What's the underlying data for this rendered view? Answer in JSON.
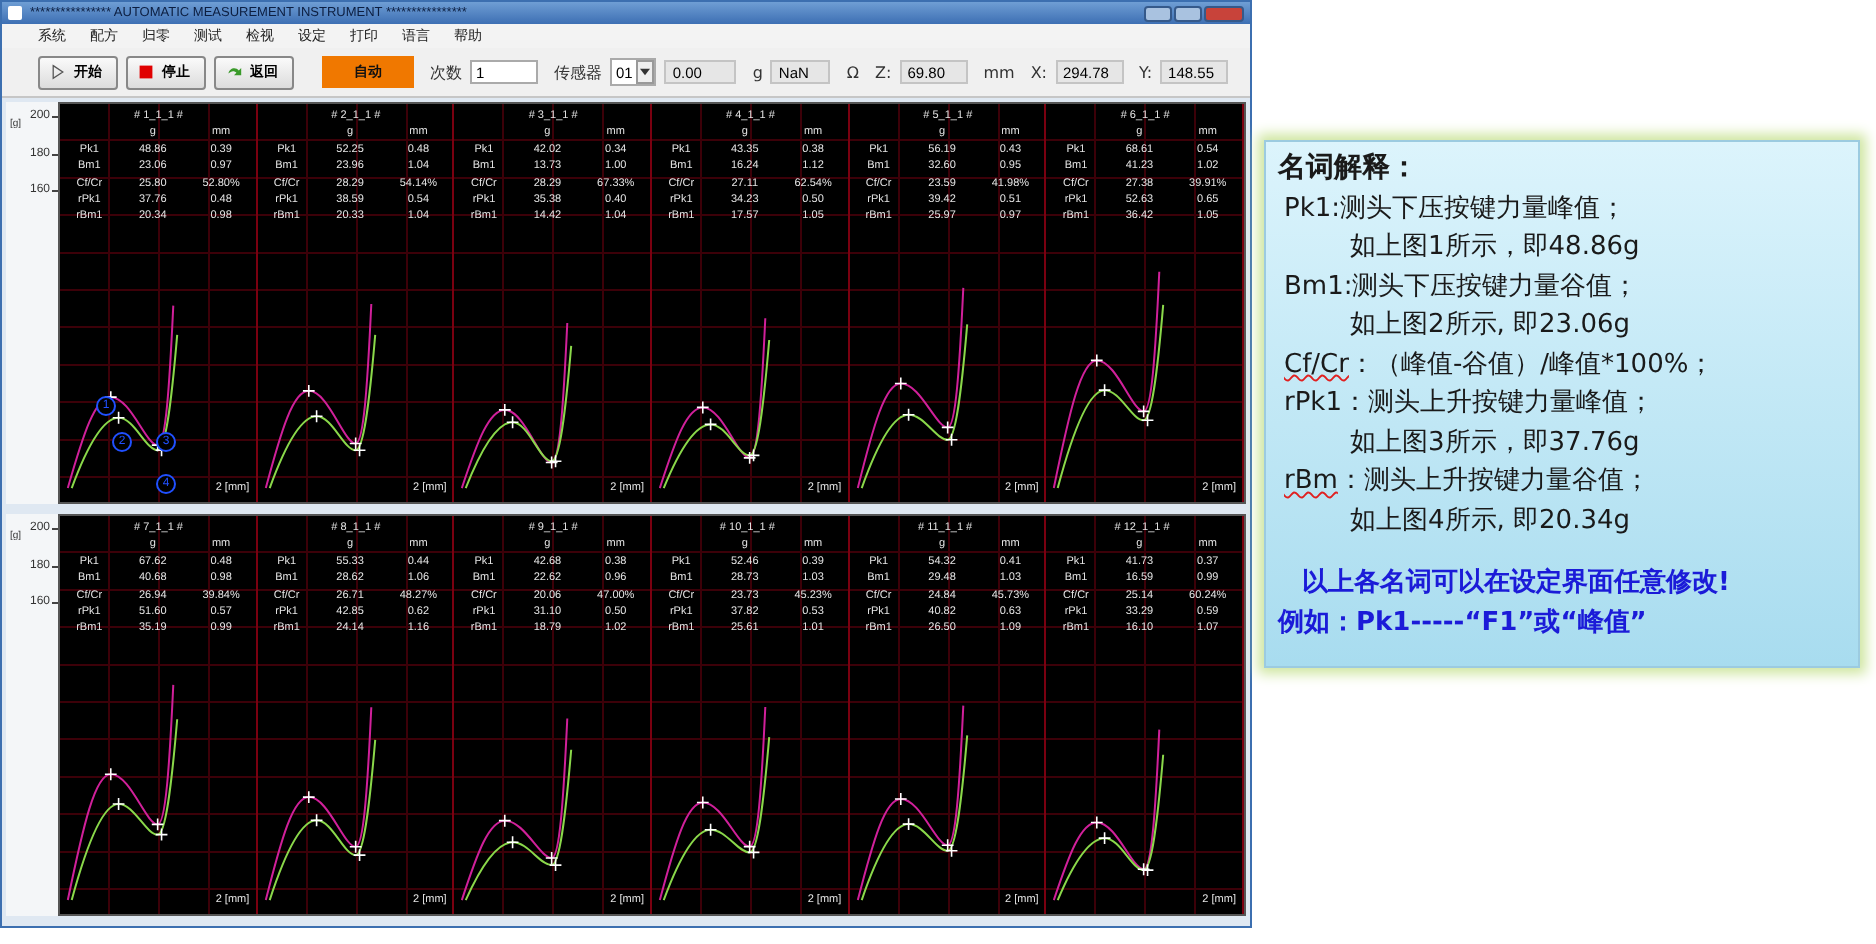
{
  "window": {
    "title": "**************** AUTOMATIC MEASUREMENT INSTRUMENT ****************"
  },
  "menu": [
    "系统",
    "配方",
    "归零",
    "测试",
    "检视",
    "设定",
    "打印",
    "语言",
    "帮助"
  ],
  "toolbar": {
    "buttons": [
      {
        "kind": "start",
        "label": "开始"
      },
      {
        "kind": "stop",
        "label": "停止"
      },
      {
        "kind": "back",
        "label": "返回"
      }
    ],
    "mode": "自动",
    "count_label": "次数",
    "count": "1",
    "sensor_label": "传感器",
    "sensor": "01",
    "force": "0.00",
    "force_unit": "g",
    "resistance": "NaN",
    "resistance_unit": "Ω",
    "coords": [
      {
        "label": "Z:",
        "value": "69.80",
        "unit": "mm"
      },
      {
        "label": "X:",
        "value": "294.78"
      },
      {
        "label": "Y:",
        "value": "148.55"
      }
    ]
  },
  "panes": [
    {
      "y_unit": "[g]",
      "y_ticks": [
        "200",
        "180",
        "160"
      ],
      "plots": [
        {
          "title": "# 1_1_1 #",
          "units": [
            "g",
            "mm"
          ],
          "rows": [
            [
              "Pk1",
              "48.86",
              "0.39"
            ],
            [
              "Bm1",
              "23.06",
              "0.97"
            ],
            [
              "Cf/Cr",
              "25.80",
              "52.80%"
            ],
            [
              "rPk1",
              "37.76",
              "0.48"
            ],
            [
              "rBm1",
              "20.34",
              "0.98"
            ]
          ],
          "x_label": "2 [mm]",
          "callouts": [
            "1",
            "2",
            "3",
            "4"
          ]
        },
        {
          "title": "# 2_1_1 #",
          "units": [
            "g",
            "mm"
          ],
          "rows": [
            [
              "Pk1",
              "52.25",
              "0.48"
            ],
            [
              "Bm1",
              "23.96",
              "1.04"
            ],
            [
              "Cf/Cr",
              "28.29",
              "54.14%"
            ],
            [
              "rPk1",
              "38.59",
              "0.54"
            ],
            [
              "rBm1",
              "20.33",
              "1.04"
            ]
          ],
          "x_label": "2 [mm]"
        },
        {
          "title": "# 3_1_1 #",
          "units": [
            "g",
            "mm"
          ],
          "rows": [
            [
              "Pk1",
              "42.02",
              "0.34"
            ],
            [
              "Bm1",
              "13.73",
              "1.00"
            ],
            [
              "Cf/Cr",
              "28.29",
              "67.33%"
            ],
            [
              "rPk1",
              "35.38",
              "0.40"
            ],
            [
              "rBm1",
              "14.42",
              "1.04"
            ]
          ],
          "x_label": "2 [mm]"
        },
        {
          "title": "# 4_1_1 #",
          "units": [
            "g",
            "mm"
          ],
          "rows": [
            [
              "Pk1",
              "43.35",
              "0.38"
            ],
            [
              "Bm1",
              "16.24",
              "1.12"
            ],
            [
              "Cf/Cr",
              "27.11",
              "62.54%"
            ],
            [
              "rPk1",
              "34.23",
              "0.50"
            ],
            [
              "rBm1",
              "17.57",
              "1.05"
            ]
          ],
          "x_label": "2 [mm]"
        },
        {
          "title": "# 5_1_1 #",
          "units": [
            "g",
            "mm"
          ],
          "rows": [
            [
              "Pk1",
              "56.19",
              "0.43"
            ],
            [
              "Bm1",
              "32.60",
              "0.95"
            ],
            [
              "Cf/Cr",
              "23.59",
              "41.98%"
            ],
            [
              "rPk1",
              "39.42",
              "0.51"
            ],
            [
              "rBm1",
              "25.97",
              "0.97"
            ]
          ],
          "x_label": "2 [mm]"
        },
        {
          "title": "# 6_1_1 #",
          "units": [
            "g",
            "mm"
          ],
          "rows": [
            [
              "Pk1",
              "68.61",
              "0.54"
            ],
            [
              "Bm1",
              "41.23",
              "1.02"
            ],
            [
              "Cf/Cr",
              "27.38",
              "39.91%"
            ],
            [
              "rPk1",
              "52.63",
              "0.65"
            ],
            [
              "rBm1",
              "36.42",
              "1.05"
            ]
          ],
          "x_label": "2 [mm]"
        }
      ]
    },
    {
      "y_unit": "[g]",
      "y_ticks": [
        "200",
        "180",
        "160"
      ],
      "plots": [
        {
          "title": "# 7_1_1 #",
          "units": [
            "g",
            "mm"
          ],
          "rows": [
            [
              "Pk1",
              "67.62",
              "0.48"
            ],
            [
              "Bm1",
              "40.68",
              "0.98"
            ],
            [
              "Cf/Cr",
              "26.94",
              "39.84%"
            ],
            [
              "rPk1",
              "51.60",
              "0.57"
            ],
            [
              "rBm1",
              "35.19",
              "0.99"
            ]
          ],
          "x_label": "2 [mm]"
        },
        {
          "title": "# 8_1_1 #",
          "units": [
            "g",
            "mm"
          ],
          "rows": [
            [
              "Pk1",
              "55.33",
              "0.44"
            ],
            [
              "Bm1",
              "28.62",
              "1.06"
            ],
            [
              "Cf/Cr",
              "26.71",
              "48.27%"
            ],
            [
              "rPk1",
              "42.85",
              "0.62"
            ],
            [
              "rBm1",
              "24.14",
              "1.16"
            ]
          ],
          "x_label": "2 [mm]"
        },
        {
          "title": "# 9_1_1 #",
          "units": [
            "g",
            "mm"
          ],
          "rows": [
            [
              "Pk1",
              "42.68",
              "0.38"
            ],
            [
              "Bm1",
              "22.62",
              "0.96"
            ],
            [
              "Cf/Cr",
              "20.06",
              "47.00%"
            ],
            [
              "rPk1",
              "31.10",
              "0.50"
            ],
            [
              "rBm1",
              "18.79",
              "1.02"
            ]
          ],
          "x_label": "2 [mm]"
        },
        {
          "title": "# 10_1_1 #",
          "units": [
            "g",
            "mm"
          ],
          "rows": [
            [
              "Pk1",
              "52.46",
              "0.39"
            ],
            [
              "Bm1",
              "28.73",
              "1.03"
            ],
            [
              "Cf/Cr",
              "23.73",
              "45.23%"
            ],
            [
              "rPk1",
              "37.82",
              "0.53"
            ],
            [
              "rBm1",
              "25.61",
              "1.01"
            ]
          ],
          "x_label": "2 [mm]"
        },
        {
          "title": "# 11_1_1 #",
          "units": [
            "g",
            "mm"
          ],
          "rows": [
            [
              "Pk1",
              "54.32",
              "0.41"
            ],
            [
              "Bm1",
              "29.48",
              "1.03"
            ],
            [
              "Cf/Cr",
              "24.84",
              "45.73%"
            ],
            [
              "rPk1",
              "40.82",
              "0.63"
            ],
            [
              "rBm1",
              "26.50",
              "1.09"
            ]
          ],
          "x_label": "2 [mm]"
        },
        {
          "title": "# 12_1_1 #",
          "units": [
            "g",
            "mm"
          ],
          "rows": [
            [
              "Pk1",
              "41.73",
              "0.37"
            ],
            [
              "Bm1",
              "16.59",
              "0.99"
            ],
            [
              "Cf/Cr",
              "25.14",
              "60.24%"
            ],
            [
              "rPk1",
              "33.29",
              "0.59"
            ],
            [
              "rBm1",
              "16.10",
              "1.07"
            ]
          ],
          "x_label": "2 [mm]"
        }
      ]
    }
  ],
  "glossary": {
    "title": "名词解释：",
    "entries": [
      {
        "term": "Pk1:",
        "flagged": false,
        "definition": "测头下压按键力量峰值；",
        "example": "如上图1所示，即48.86g"
      },
      {
        "term": "Bm1:",
        "flagged": false,
        "definition": "测头下压按键力量谷值；",
        "example": "如上图2所示, 即23.06g"
      },
      {
        "term": "Cf/Cr",
        "flagged": true,
        "definition": "：（峰值-谷值）/峰值*100%；"
      },
      {
        "term": "rPk1",
        "flagged": false,
        "definition": "：测头上升按键力量峰值；",
        "example": "如上图3所示，即37.76g"
      },
      {
        "term": "rBm",
        "flagged": true,
        "definition": "：测头上升按键力量谷值；",
        "example": "如上图4所示, 即20.34g"
      }
    ],
    "notes": [
      "以上各名词可以在设定界面任意修改!",
      "例如：Pk1-----“F1”或“峰值”"
    ]
  }
}
